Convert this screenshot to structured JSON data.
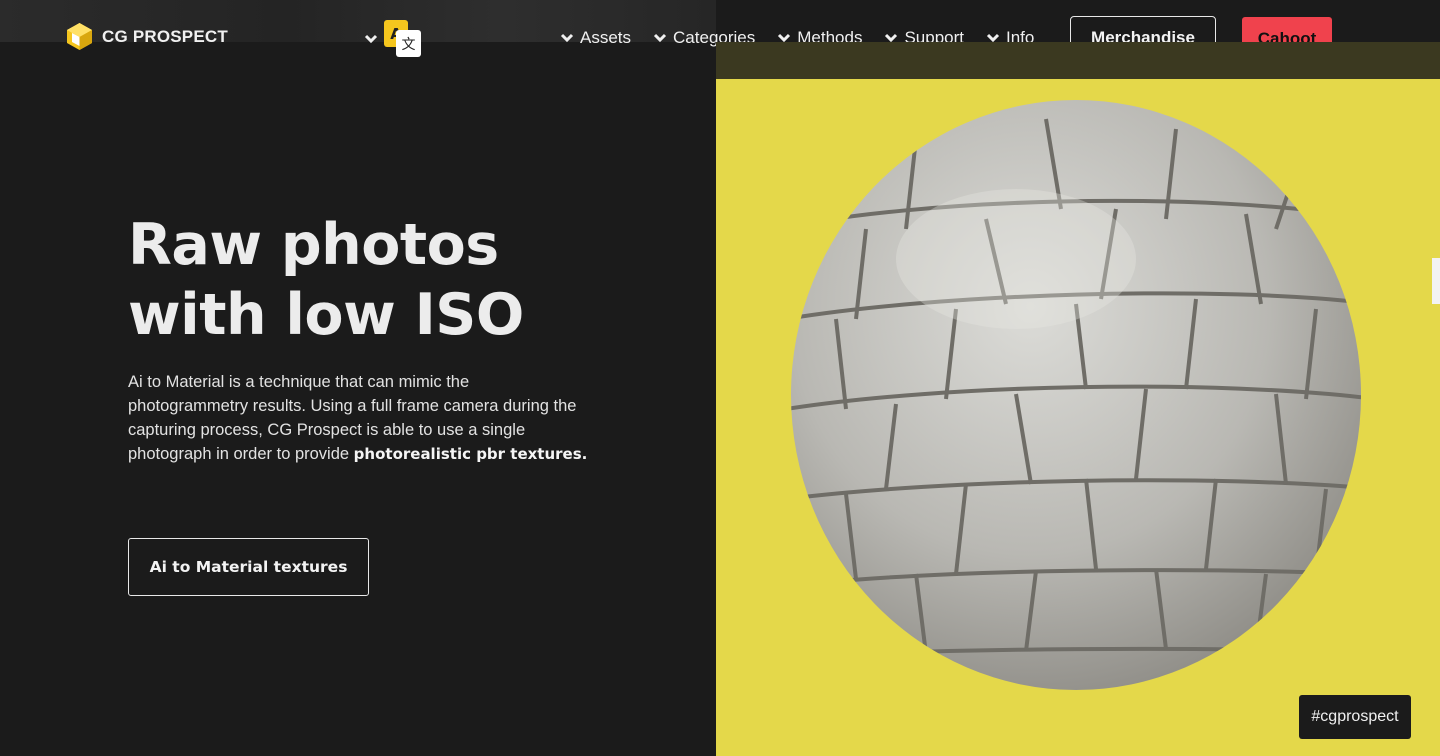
{
  "header": {
    "logo_text": "CG PROSPECT",
    "language_icon_glyphs": {
      "left": "A",
      "right": "文"
    },
    "nav": [
      {
        "label": "Assets"
      },
      {
        "label": "Categories"
      },
      {
        "label": "Methods"
      },
      {
        "label": "Support"
      },
      {
        "label": "Info"
      }
    ],
    "merch_label": "Merchandise",
    "cahoot_label": "Cahoot"
  },
  "hero": {
    "title_line1": "Raw photos",
    "title_line2": "with low ISO",
    "description": "Ai to Material is a technique that can mimic the photogrammetry results. Using a full frame camera during the capturing process, CG Prospect is able to use a single photograph in order to provide",
    "description_bold": "photorealistic pbr textures.",
    "cta_label": "Ai to Material textures"
  },
  "image": {
    "hashtag": "#cgprospect"
  },
  "colors": {
    "background": "#1b1b1b",
    "accent_red": "#f0424d",
    "panel_yellow": "#e4d84a",
    "logo_yellow": "#f5c61e"
  },
  "icons": [
    "logo-cube-icon",
    "chevron-down-icon",
    "translate-icon"
  ]
}
